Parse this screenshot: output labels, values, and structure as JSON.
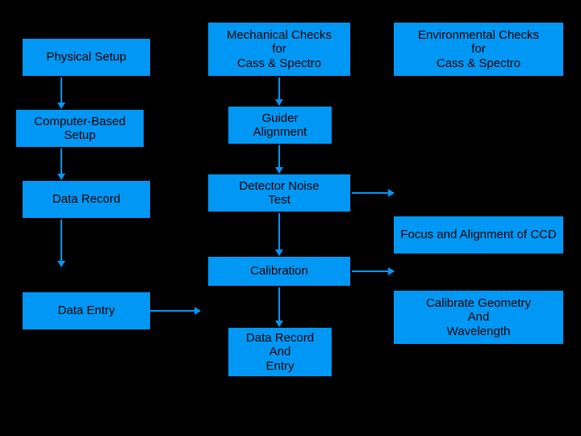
{
  "boxes": {
    "physical_setup": "Physical Setup",
    "computer_based_setup": "Computer-Based Setup",
    "data_record": "Data Record",
    "data_entry": "Data Entry",
    "mech_checks": "Mechanical Checks\nfor\nCass & Spectro",
    "guider_alignment": "Guider\nAlignment",
    "detector_noise": "Detector Noise\nTest",
    "calibration": "Calibration",
    "data_record_entry": "Data Record\nAnd\nEntry",
    "env_checks": "Environmental Checks\nfor\nCass & Spectro",
    "focus_align_ccd": "Focus and Alignment of CCD",
    "calib_geom_wave": "Calibrate  Geometry\nAnd\nWavelength"
  },
  "colors": {
    "box_bg": "#0098f4",
    "arrow": "#0098f4",
    "bg": "#000000"
  }
}
